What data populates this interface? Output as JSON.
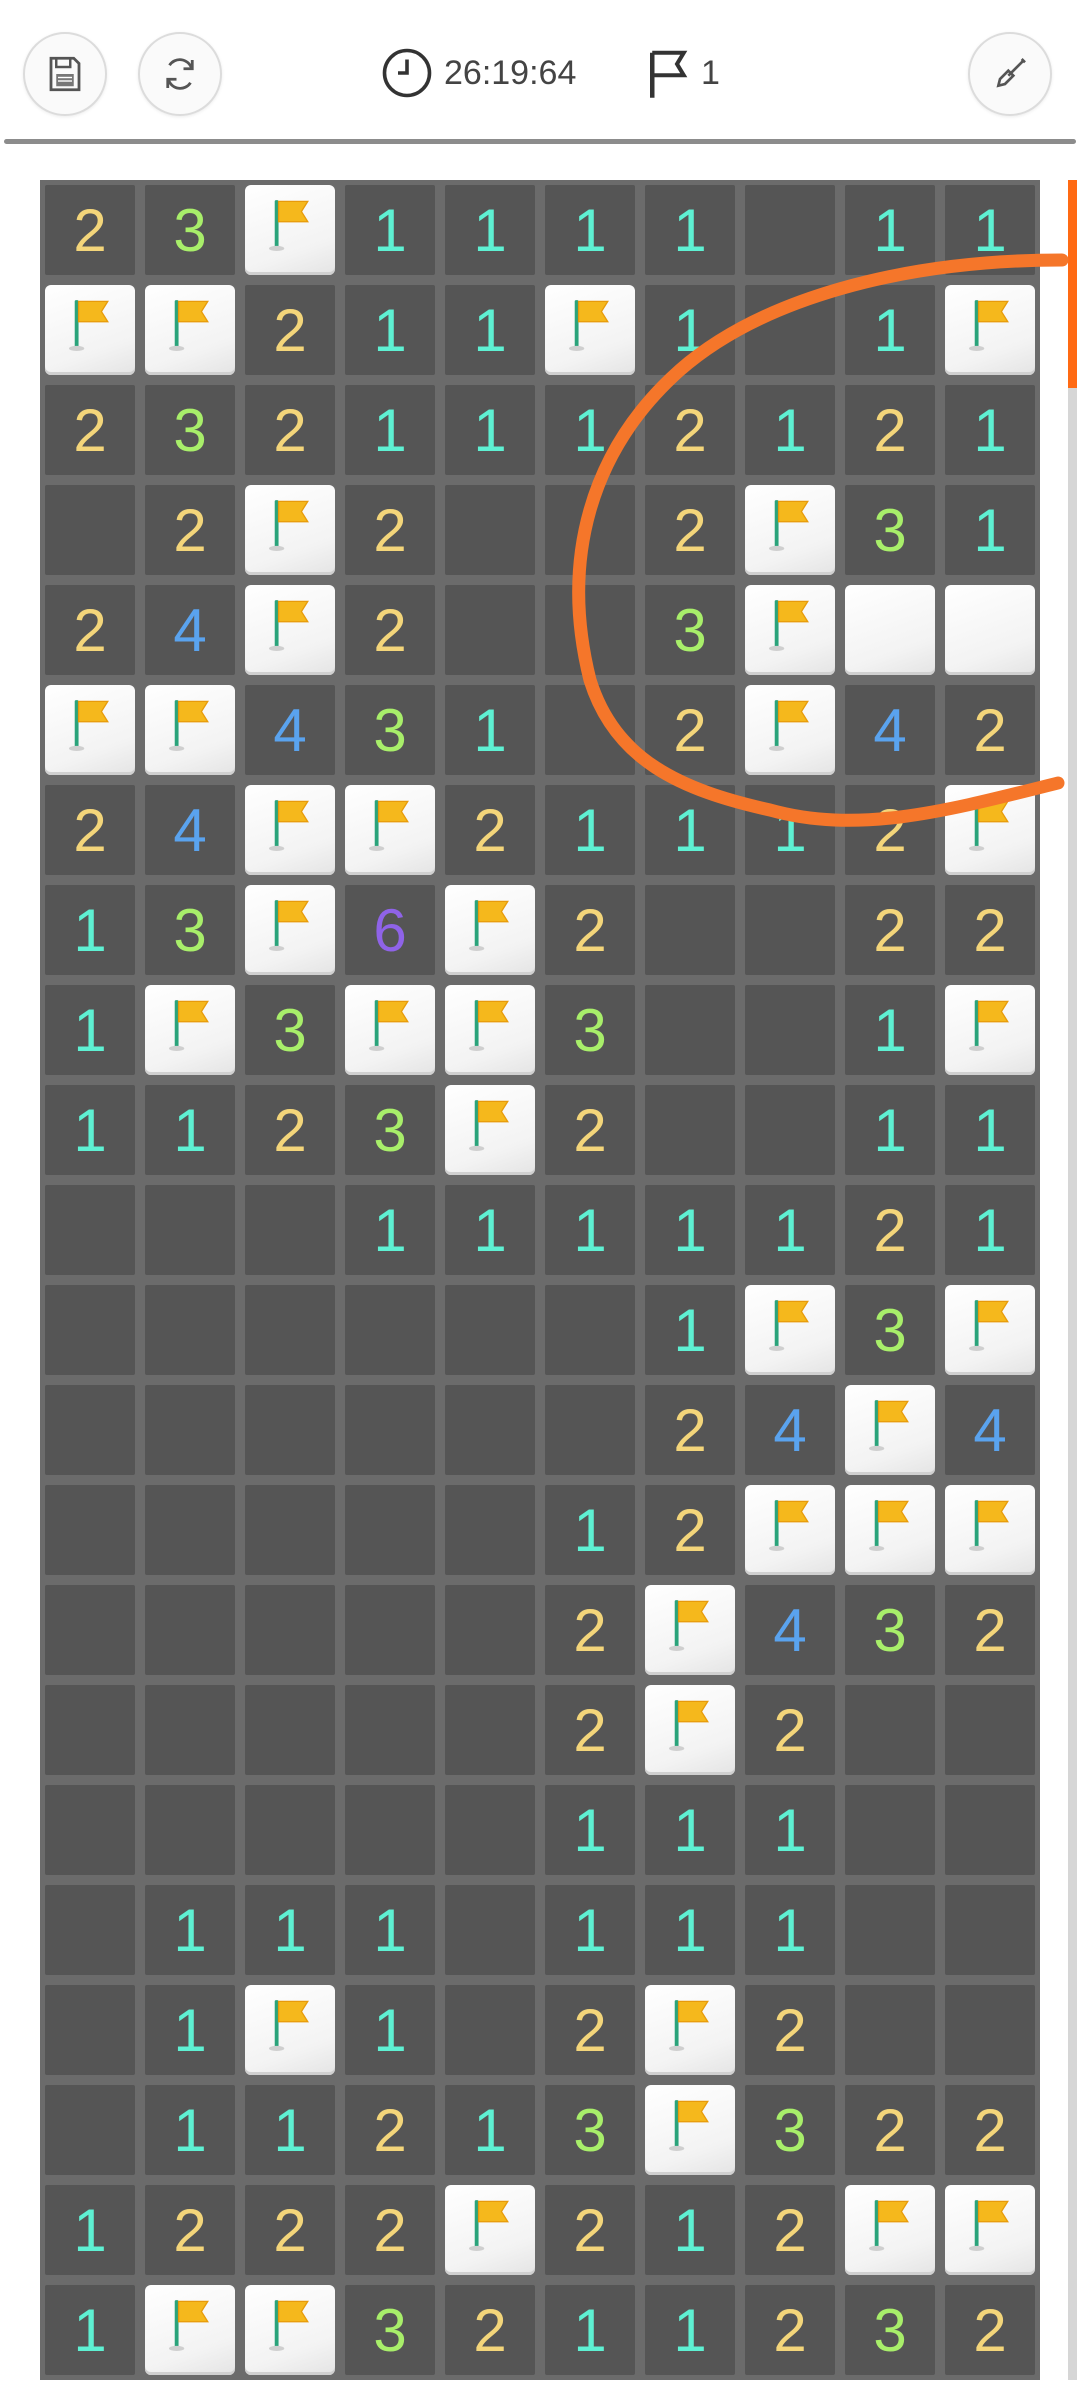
{
  "header": {
    "save_icon": "floppy-disk-icon",
    "restart_icon": "refresh-icon",
    "timer_icon": "clock-icon",
    "timer": "26:19:64",
    "flag_icon": "flag-icon",
    "flag_count": "1",
    "mode_icon": "shovel-icon"
  },
  "colors": {
    "board_bg": "#555555",
    "grid": "#6b6b6b",
    "number_1": "#5ef0d2",
    "number_2": "#f3d57a",
    "number_3": "#a8ee6a",
    "number_4": "#5aa3ee",
    "number_6": "#8f63e8",
    "flag": "#f5b81c",
    "annotation_stroke": "#f5762a",
    "scroll_thumb": "#ff6a13"
  },
  "legend": {
    "F": "flagged-cell",
    "C": "covered-cell",
    "E": "empty-cell"
  },
  "board": {
    "rows": [
      [
        "2",
        "3",
        "F",
        "1",
        "1",
        "1",
        "1",
        "E",
        "1",
        "1"
      ],
      [
        "F",
        "F",
        "2",
        "1",
        "1",
        "F",
        "1",
        "E",
        "1",
        "F"
      ],
      [
        "2",
        "3",
        "2",
        "1",
        "1",
        "1",
        "2",
        "1",
        "2",
        "1"
      ],
      [
        "E",
        "2",
        "F",
        "2",
        "E",
        "E",
        "2",
        "F",
        "3",
        "1"
      ],
      [
        "2",
        "4",
        "F",
        "2",
        "E",
        "E",
        "3",
        "F",
        "C",
        "C"
      ],
      [
        "F",
        "F",
        "4",
        "3",
        "1",
        "E",
        "2",
        "F",
        "4",
        "2"
      ],
      [
        "2",
        "4",
        "F",
        "F",
        "2",
        "1",
        "1",
        "1",
        "2",
        "F"
      ],
      [
        "1",
        "3",
        "F",
        "6",
        "F",
        "2",
        "E",
        "E",
        "2",
        "2"
      ],
      [
        "1",
        "F",
        "3",
        "F",
        "F",
        "3",
        "E",
        "E",
        "1",
        "F"
      ],
      [
        "1",
        "1",
        "2",
        "3",
        "F",
        "2",
        "E",
        "E",
        "1",
        "1"
      ],
      [
        "E",
        "E",
        "E",
        "1",
        "1",
        "1",
        "1",
        "1",
        "2",
        "1"
      ],
      [
        "E",
        "E",
        "E",
        "E",
        "E",
        "E",
        "1",
        "F",
        "3",
        "F"
      ],
      [
        "E",
        "E",
        "E",
        "E",
        "E",
        "E",
        "2",
        "4",
        "F",
        "4"
      ],
      [
        "E",
        "E",
        "E",
        "E",
        "E",
        "1",
        "2",
        "F",
        "F",
        "F"
      ],
      [
        "E",
        "E",
        "E",
        "E",
        "E",
        "2",
        "F",
        "4",
        "3",
        "2"
      ],
      [
        "E",
        "E",
        "E",
        "E",
        "E",
        "2",
        "F",
        "2",
        "E",
        "E"
      ],
      [
        "E",
        "E",
        "E",
        "E",
        "E",
        "1",
        "1",
        "1",
        "E",
        "E"
      ],
      [
        "E",
        "1",
        "1",
        "1",
        "E",
        "1",
        "1",
        "1",
        "E",
        "E"
      ],
      [
        "E",
        "1",
        "F",
        "1",
        "E",
        "2",
        "F",
        "2",
        "E",
        "E"
      ],
      [
        "E",
        "1",
        "1",
        "2",
        "1",
        "3",
        "F",
        "3",
        "2",
        "2"
      ],
      [
        "1",
        "2",
        "2",
        "2",
        "F",
        "2",
        "1",
        "2",
        "F",
        "F"
      ],
      [
        "1",
        "F",
        "F",
        "3",
        "2",
        "1",
        "1",
        "2",
        "3",
        "2"
      ]
    ]
  }
}
